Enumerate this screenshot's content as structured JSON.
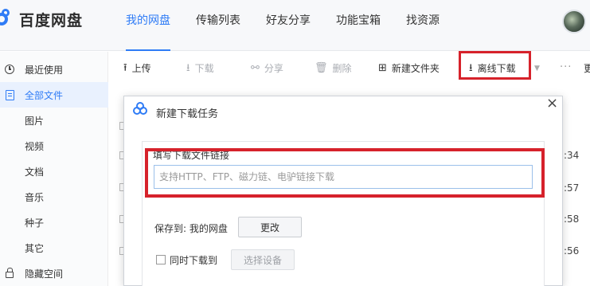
{
  "header": {
    "logo_text": "百度网盘",
    "nav": [
      "我的网盘",
      "传输列表",
      "好友分享",
      "功能宝箱",
      "找资源"
    ],
    "active_nav": "我的网盘"
  },
  "sidebar": {
    "items": [
      {
        "label": "最近使用",
        "icon": "clock-icon"
      },
      {
        "label": "全部文件",
        "icon": "document-icon"
      },
      {
        "label": "图片"
      },
      {
        "label": "视频"
      },
      {
        "label": "文档"
      },
      {
        "label": "音乐"
      },
      {
        "label": "种子"
      },
      {
        "label": "其它"
      },
      {
        "label": "隐藏空间",
        "icon": "lock-icon"
      }
    ],
    "active": "全部文件"
  },
  "toolbar": {
    "upload": "上传",
    "download": "下载",
    "share": "分享",
    "delete": "删除",
    "new_folder": "新建文件夹",
    "offline_download": "离线下载",
    "more_dots": "···",
    "more_label": "更"
  },
  "background_list": {
    "times": [
      ":34",
      ":57",
      ":58",
      ":56"
    ]
  },
  "dialog": {
    "title": "新建下载任务",
    "close_symbol": "×",
    "url_label": "填写下载文件链接",
    "url_placeholder": "支持HTTP、FTP、磁力链、电驴链接下载",
    "url_value": "",
    "save_to_label": "保存到: 我的网盘",
    "change_button": "更改",
    "sync_download_label": "同时下载到",
    "sync_download_checked": false,
    "select_device_button": "选择设备"
  },
  "colors": {
    "accent": "#2f7cf6",
    "highlight_red": "#d6222b"
  }
}
